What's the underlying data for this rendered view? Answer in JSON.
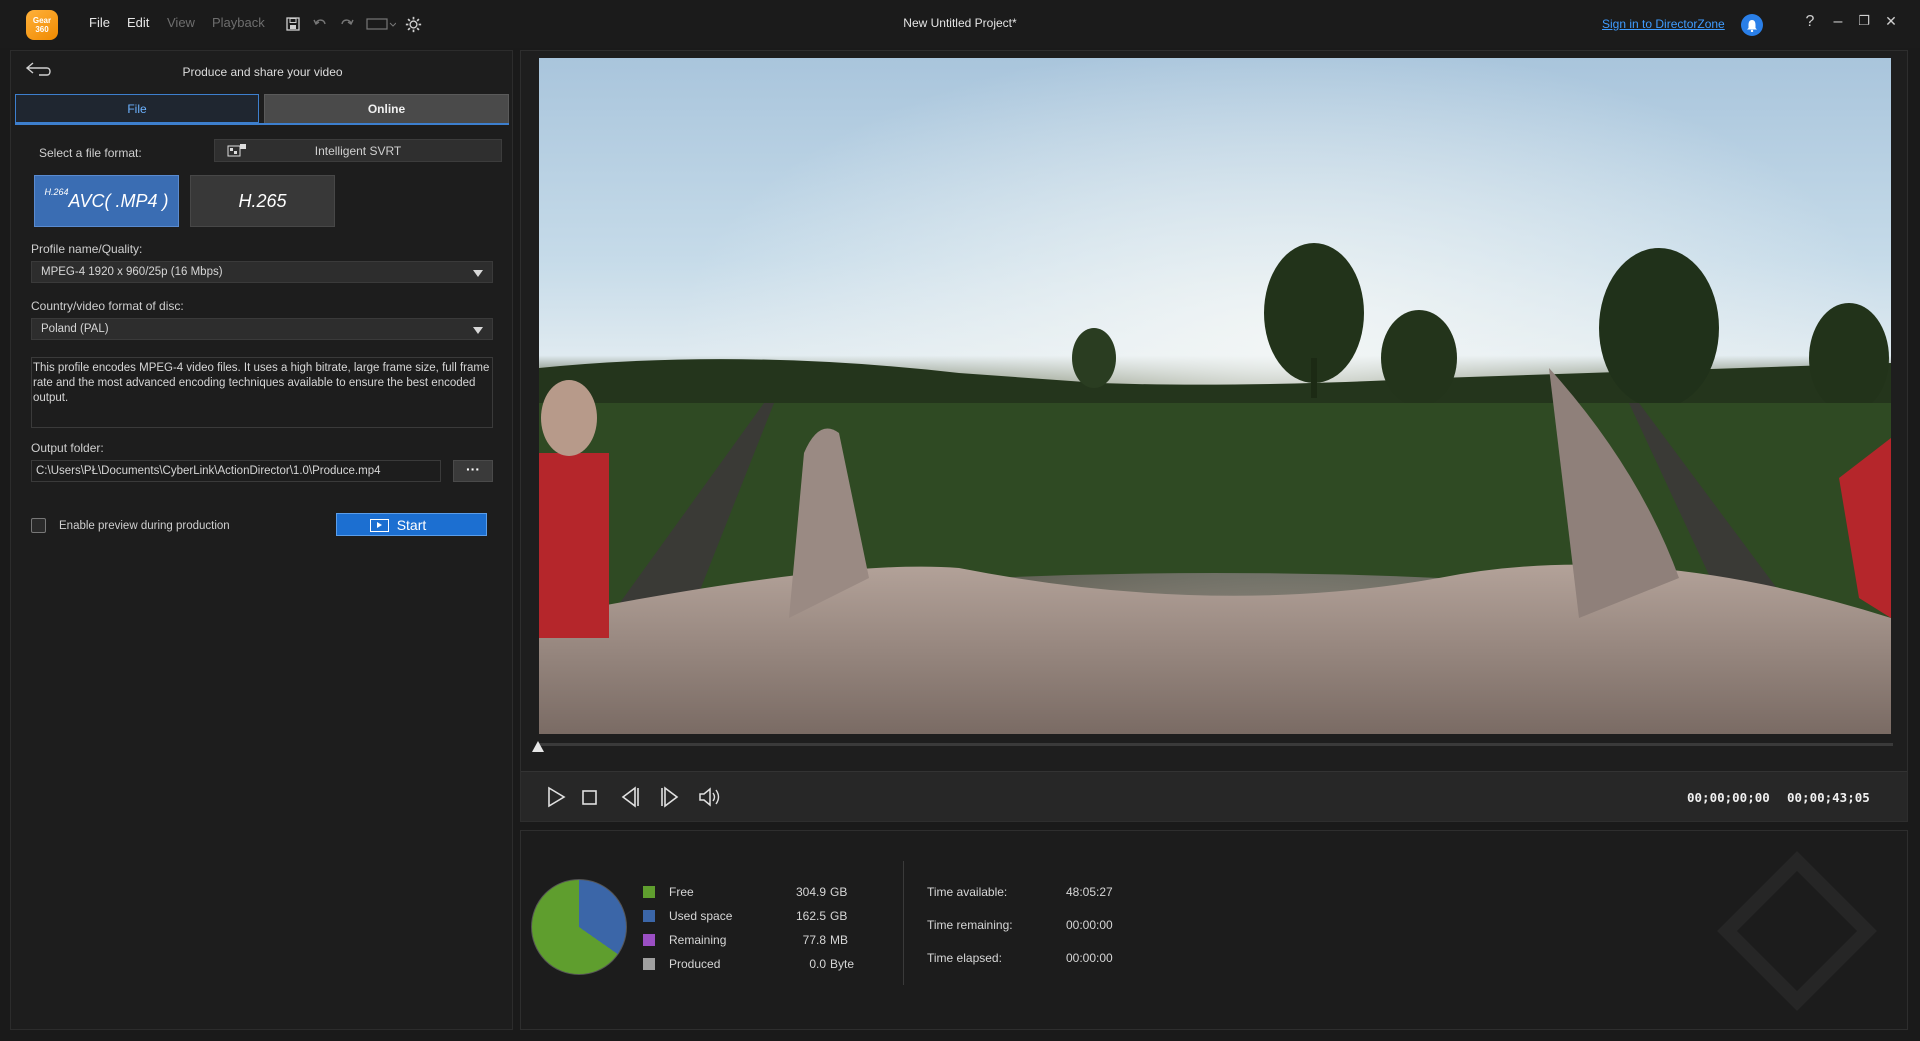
{
  "app": {
    "logo_text": "Gear 360",
    "menu": {
      "file": "File",
      "edit": "Edit",
      "view": "View",
      "playback": "Playback"
    },
    "project_title": "New Untitled Project*",
    "sign_in": "Sign in to DirectorZone",
    "window_buttons": {
      "help": "?",
      "minimize": "–",
      "restore": "❐",
      "close": "✕"
    }
  },
  "produce": {
    "title": "Produce and share your video",
    "tabs": {
      "file": "File",
      "online": "Online"
    },
    "select_format_label": "Select a file format:",
    "svrt_label": "Intelligent SVRT",
    "formats": {
      "avc_sup": "H.264",
      "avc_label": "AVC( .MP4 )",
      "h265_label": "H.265"
    },
    "profile_label": "Profile name/Quality:",
    "profile_value": "MPEG-4 1920 x 960/25p (16 Mbps)",
    "country_label": "Country/video format of disc:",
    "country_value": "Poland (PAL)",
    "description": "This profile encodes MPEG-4 video files. It uses a high bitrate, large frame size, full frame rate and the most advanced encoding techniques available to ensure the best encoded output.",
    "output_label": "Output folder:",
    "output_path": "C:\\Users\\PŁ\\Documents\\CyberLink\\ActionDirector\\1.0\\Produce.mp4",
    "browse_label": "···",
    "preview_checkbox_label": "Enable preview during production",
    "preview_checked": false,
    "start_label": "Start"
  },
  "player": {
    "current_time": "00;00;00;00",
    "total_time": "00;00;43;05",
    "playhead_fraction": 0.0
  },
  "disk": {
    "legend": [
      {
        "label": "Free",
        "value": "304.9",
        "unit": "GB",
        "color": "#5f9e2e"
      },
      {
        "label": "Used space",
        "value": "162.5",
        "unit": "GB",
        "color": "#3b66a8"
      },
      {
        "label": "Remaining",
        "value": "77.8",
        "unit": "MB",
        "color": "#9b4fc4"
      },
      {
        "label": "Produced",
        "value": "0.0",
        "unit": "Byte",
        "color": "#a0a0a0"
      }
    ],
    "times": [
      {
        "label": "Time available:",
        "value": "48:05:27"
      },
      {
        "label": "Time remaining:",
        "value": "00:00:00"
      },
      {
        "label": "Time elapsed:",
        "value": "00:00:00"
      }
    ]
  },
  "colors": {
    "accent": "#1c6fd1",
    "tab_active": "#3d7fce",
    "format_selected": "#3a6db3"
  }
}
